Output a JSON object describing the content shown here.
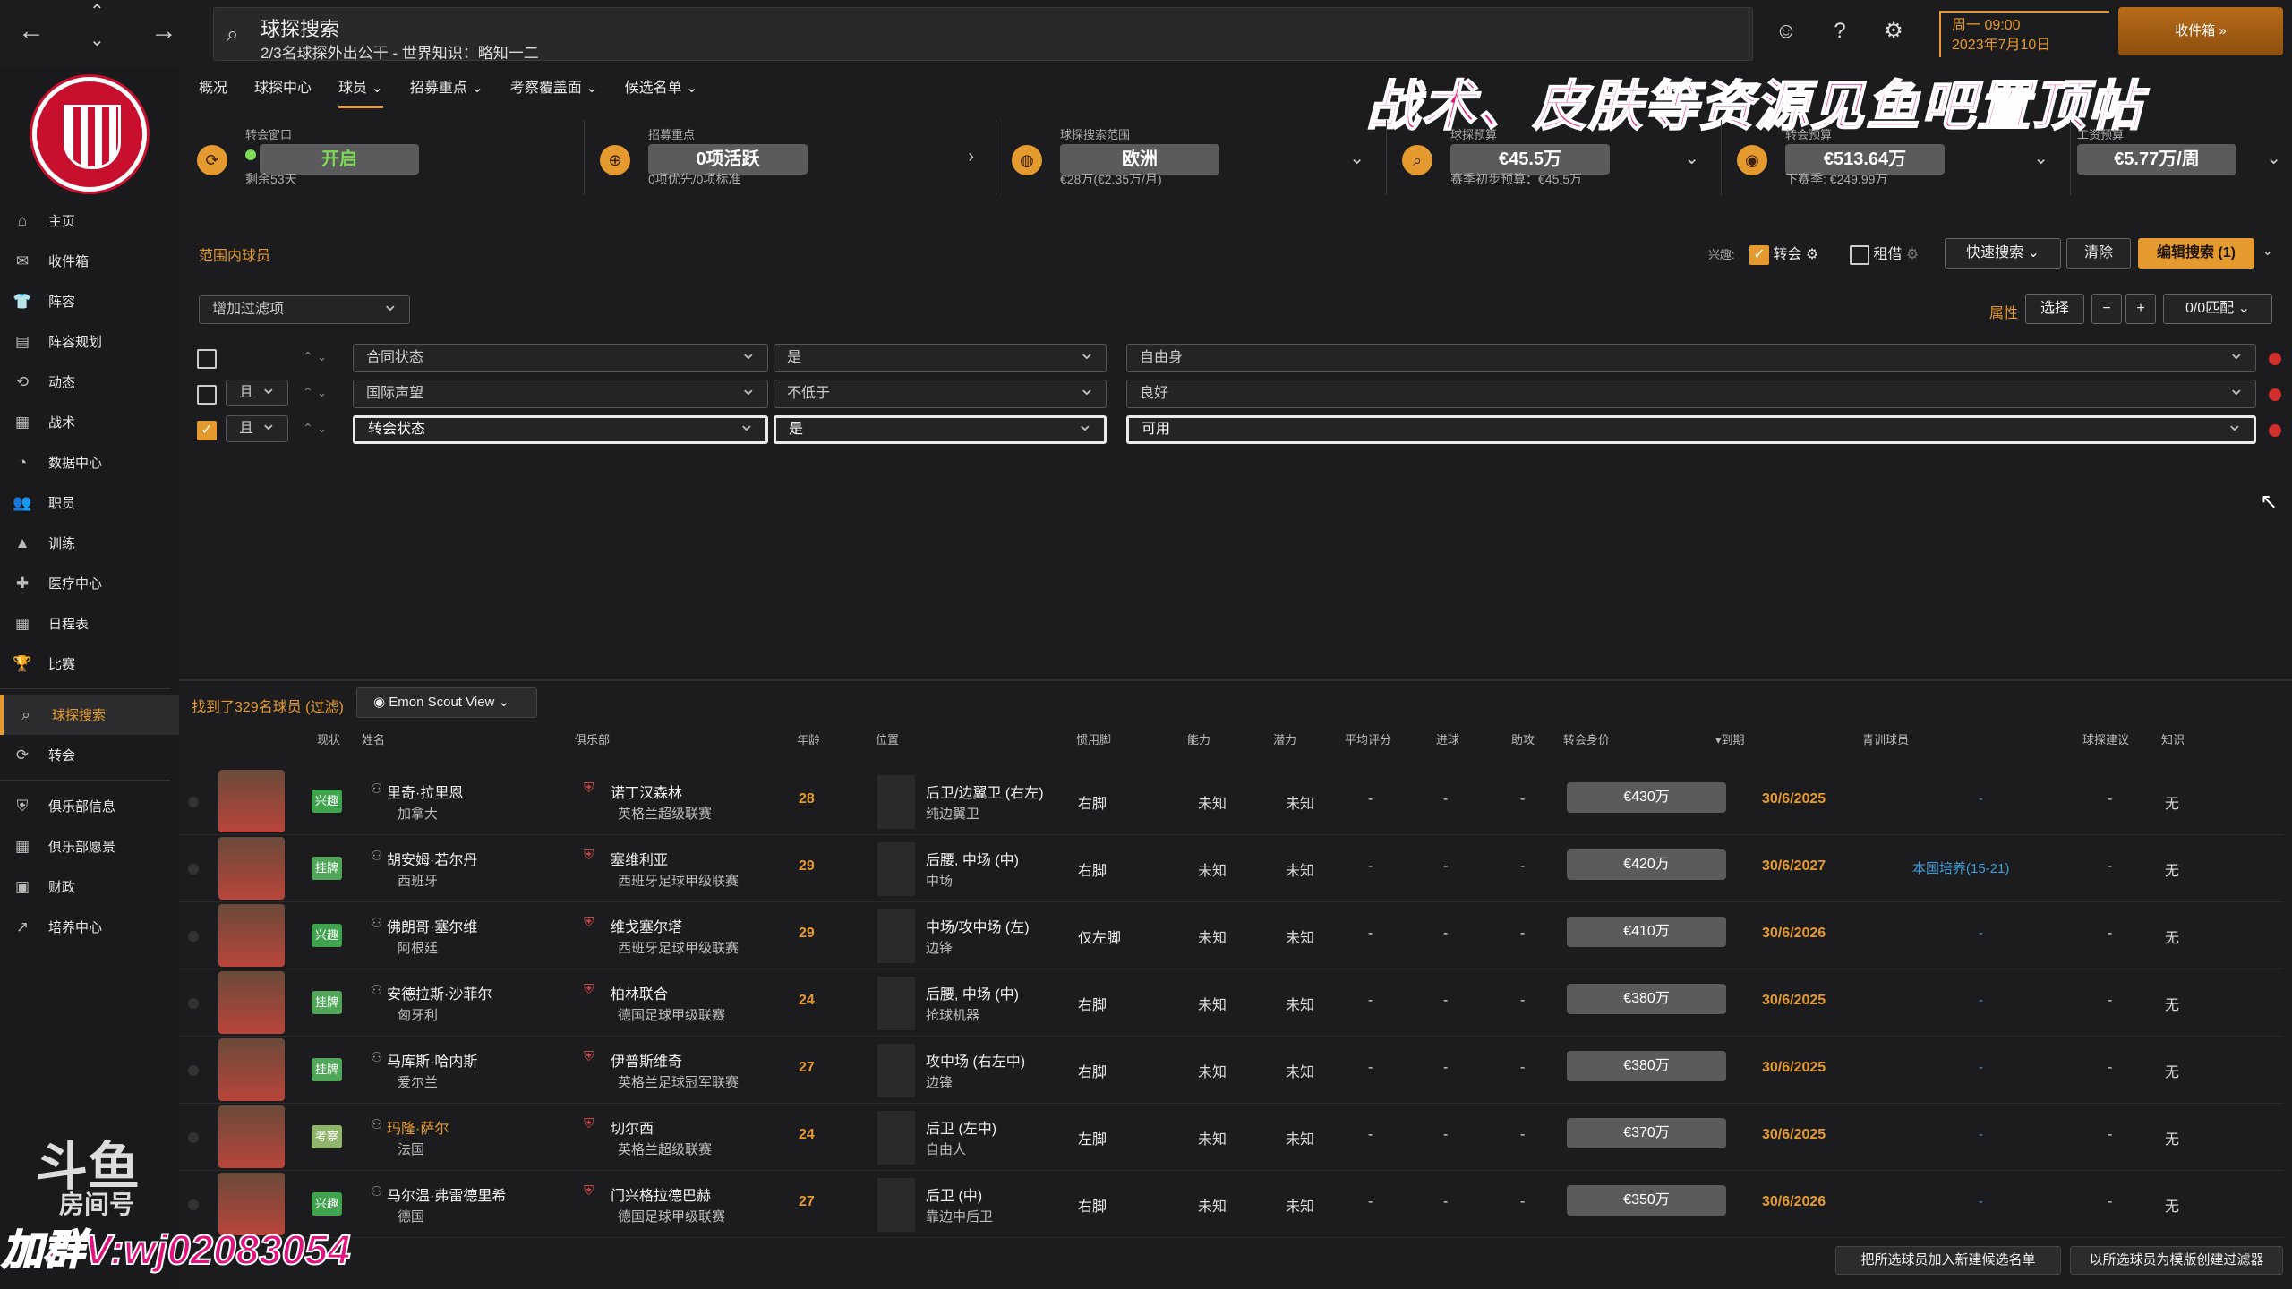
{
  "topbar": {
    "title": "球探搜索",
    "subtitle": "2/3名球探外出公干 - 世界知识：略知一二",
    "date_line1": "周一 09:00",
    "date_line2": "2023年7月10日",
    "inbox": "收件箱 »"
  },
  "sidebar": {
    "items": [
      "主页",
      "收件箱",
      "阵容",
      "阵容规划",
      "动态",
      "战术",
      "数据中心",
      "职员",
      "训练",
      "医疗中心",
      "日程表",
      "比赛",
      "球探搜索",
      "转会",
      "俱乐部信息",
      "俱乐部愿景",
      "财政",
      "培养中心"
    ],
    "active": "球探搜索"
  },
  "subnav": [
    "概况",
    "球探中心",
    "球员 ⌄",
    "招募重点 ⌄",
    "考察覆盖面 ⌄",
    "候选名单 ⌄"
  ],
  "banner": "战术、皮肤等资源见鱼吧置顶帖",
  "stats": [
    {
      "label": "转会窗口",
      "value": "开启",
      "sub": "剩余53天",
      "icon": "refresh-icon"
    },
    {
      "label": "招募重点",
      "value": "0项活跃",
      "sub": "0项优先/0项标准",
      "icon": "target-icon"
    },
    {
      "label": "球探搜索范围",
      "value": "欧洲",
      "sub": "€28万(€2.35万/月)",
      "icon": "globe-icon"
    },
    {
      "label": "球探预算",
      "value": "€45.5万",
      "sub": "赛季初步预算：€45.5万",
      "icon": "search-icon"
    },
    {
      "label": "转会预算",
      "value": "€513.64万",
      "sub": "下赛季: €249.99万",
      "icon": "piggy-icon"
    },
    {
      "label": "工资预算",
      "value": "€5.77万/周",
      "sub": "",
      "icon": ""
    }
  ],
  "filters": {
    "title": "范围内球员",
    "interest_label": "兴趣:",
    "transfer_label": "转会",
    "loan_label": "租借",
    "quick_search": "快速搜索",
    "clear": "清除",
    "edit_search": "编辑搜索 (1)",
    "add_filter": "增加过滤项",
    "attr_label": "属性",
    "select": "选择",
    "match": "0/0匹配",
    "rows": [
      {
        "checked": false,
        "logic": "",
        "field": "合同状态",
        "op": "是",
        "value": "自由身"
      },
      {
        "checked": false,
        "logic": "且",
        "field": "国际声望",
        "op": "不低于",
        "value": "良好"
      },
      {
        "checked": true,
        "logic": "且",
        "field": "转会状态",
        "op": "是",
        "value": "可用"
      }
    ]
  },
  "results": {
    "found": "找到了329名球员 (过滤)",
    "view": "Emon Scout View",
    "columns": [
      "现状",
      "姓名",
      "俱乐部",
      "年龄",
      "位置",
      "惯用脚",
      "能力",
      "潜力",
      "平均评分",
      "进球",
      "助攻",
      "转会身价",
      "▾到期",
      "青训球员",
      "球探建议",
      "知识"
    ],
    "players": [
      {
        "status": "兴趣",
        "name": "里奇·拉里恩",
        "nation": "加拿大",
        "club": "诺丁汉森林",
        "league": "英格兰超级联赛",
        "age": "28",
        "pos": "后卫/边翼卫 (右左)",
        "role": "纯边翼卫",
        "foot": "右脚",
        "ability": "未知",
        "potential": "未知",
        "rating": "-",
        "goals": "-",
        "assists": "-",
        "value": "€430万",
        "expiry": "30/6/2025",
        "youth": "-",
        "advice": "-",
        "knowledge": "无"
      },
      {
        "status": "挂牌",
        "name": "胡安姆·若尔丹",
        "nation": "西班牙",
        "club": "塞维利亚",
        "league": "西班牙足球甲级联赛",
        "age": "29",
        "pos": "后腰, 中场 (中)",
        "role": "中场",
        "foot": "右脚",
        "ability": "未知",
        "potential": "未知",
        "rating": "-",
        "goals": "-",
        "assists": "-",
        "value": "€420万",
        "expiry": "30/6/2027",
        "youth": "本国培养(15-21)",
        "advice": "-",
        "knowledge": "无"
      },
      {
        "status": "兴趣",
        "name": "佛朗哥·塞尔维",
        "nation": "阿根廷",
        "club": "维戈塞尔塔",
        "league": "西班牙足球甲级联赛",
        "age": "29",
        "pos": "中场/攻中场 (左)",
        "role": "边锋",
        "foot": "仅左脚",
        "ability": "未知",
        "potential": "未知",
        "rating": "-",
        "goals": "-",
        "assists": "-",
        "value": "€410万",
        "expiry": "30/6/2026",
        "youth": "-",
        "advice": "-",
        "knowledge": "无"
      },
      {
        "status": "挂牌",
        "name": "安德拉斯·沙菲尔",
        "nation": "匈牙利",
        "club": "柏林联合",
        "league": "德国足球甲级联赛",
        "age": "24",
        "pos": "后腰, 中场 (中)",
        "role": "抢球机器",
        "foot": "右脚",
        "ability": "未知",
        "potential": "未知",
        "rating": "-",
        "goals": "-",
        "assists": "-",
        "value": "€380万",
        "expiry": "30/6/2025",
        "youth": "-",
        "advice": "-",
        "knowledge": "无"
      },
      {
        "status": "挂牌",
        "name": "马库斯·哈内斯",
        "nation": "爱尔兰",
        "club": "伊普斯维奇",
        "league": "英格兰足球冠军联赛",
        "age": "27",
        "pos": "攻中场 (右左中)",
        "role": "边锋",
        "foot": "右脚",
        "ability": "未知",
        "potential": "未知",
        "rating": "-",
        "goals": "-",
        "assists": "-",
        "value": "€380万",
        "expiry": "30/6/2025",
        "youth": "-",
        "advice": "-",
        "knowledge": "无"
      },
      {
        "status": "考察",
        "name": "玛隆·萨尔",
        "nation": "法国",
        "club": "切尔西",
        "league": "英格兰超级联赛",
        "age": "24",
        "pos": "后卫 (左中)",
        "role": "自由人",
        "foot": "左脚",
        "ability": "未知",
        "potential": "未知",
        "rating": "-",
        "goals": "-",
        "assists": "-",
        "value": "€370万",
        "expiry": "30/6/2025",
        "youth": "-",
        "advice": "-",
        "knowledge": "无"
      },
      {
        "status": "兴趣",
        "name": "马尔温·弗雷德里希",
        "nation": "德国",
        "club": "门兴格拉德巴赫",
        "league": "德国足球甲级联赛",
        "age": "27",
        "pos": "后卫 (中)",
        "role": "靠边中后卫",
        "foot": "右脚",
        "ability": "未知",
        "potential": "未知",
        "rating": "-",
        "goals": "-",
        "assists": "-",
        "value": "€350万",
        "expiry": "30/6/2026",
        "youth": "-",
        "advice": "-",
        "knowledge": "无"
      }
    ]
  },
  "bottom": {
    "add_shortlist": "把所选球员加入新建候选名单",
    "create_filter": "以所选球员为模版创建过滤器"
  },
  "watermark": {
    "brand": "斗鱼",
    "room": "房间号",
    "contact": "加群V:wj02083054"
  }
}
